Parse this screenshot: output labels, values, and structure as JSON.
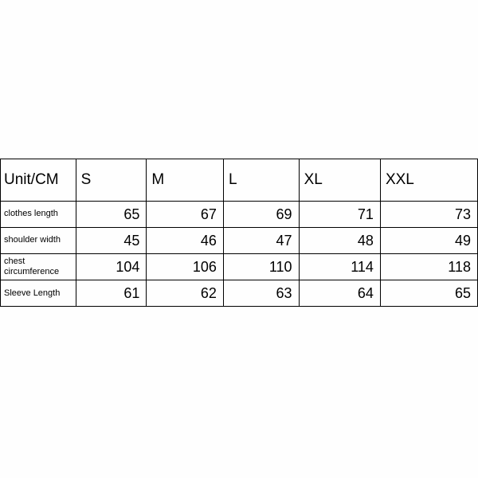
{
  "chart_data": {
    "type": "table",
    "title": "",
    "header_label": "Unit/CM",
    "columns": [
      "S",
      "M",
      "L",
      "XL",
      "XXL"
    ],
    "rows": [
      {
        "label": "clothes length",
        "values": [
          65,
          67,
          69,
          71,
          73
        ]
      },
      {
        "label": "shoulder width",
        "values": [
          45,
          46,
          47,
          48,
          49
        ]
      },
      {
        "label": "chest circumference",
        "values": [
          104,
          106,
          110,
          114,
          118
        ]
      },
      {
        "label": "Sleeve Length",
        "values": [
          61,
          62,
          63,
          64,
          65
        ]
      }
    ]
  }
}
